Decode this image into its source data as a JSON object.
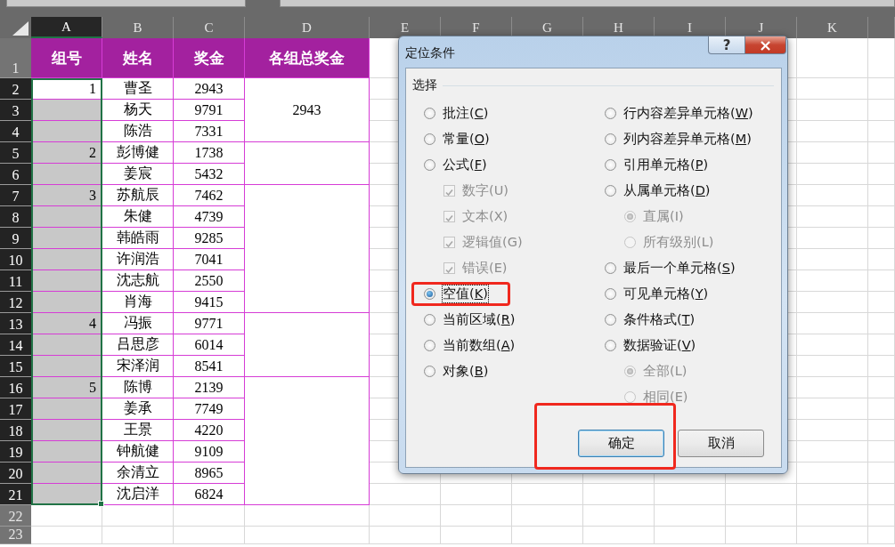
{
  "sheet": {
    "columns": [
      {
        "label": "A",
        "selected": true
      },
      {
        "label": "B",
        "selected": false
      },
      {
        "label": "C",
        "selected": false
      },
      {
        "label": "D",
        "selected": false
      },
      {
        "label": "E",
        "selected": false
      },
      {
        "label": "F",
        "selected": false
      },
      {
        "label": "G",
        "selected": false
      },
      {
        "label": "H",
        "selected": false
      },
      {
        "label": "I",
        "selected": false
      },
      {
        "label": "J",
        "selected": false
      },
      {
        "label": "K",
        "selected": false
      }
    ],
    "row_headers": [
      {
        "label": "1",
        "selected": false
      },
      {
        "label": "2",
        "selected": true
      },
      {
        "label": "3",
        "selected": true
      },
      {
        "label": "4",
        "selected": true
      },
      {
        "label": "5",
        "selected": true
      },
      {
        "label": "6",
        "selected": true
      },
      {
        "label": "7",
        "selected": true
      },
      {
        "label": "8",
        "selected": true
      },
      {
        "label": "9",
        "selected": true
      },
      {
        "label": "10",
        "selected": true
      },
      {
        "label": "11",
        "selected": true
      },
      {
        "label": "12",
        "selected": true
      },
      {
        "label": "13",
        "selected": true
      },
      {
        "label": "14",
        "selected": true
      },
      {
        "label": "15",
        "selected": true
      },
      {
        "label": "16",
        "selected": true
      },
      {
        "label": "17",
        "selected": true
      },
      {
        "label": "18",
        "selected": true
      },
      {
        "label": "19",
        "selected": true
      },
      {
        "label": "20",
        "selected": true
      },
      {
        "label": "21",
        "selected": true
      },
      {
        "label": "22",
        "selected": false
      },
      {
        "label": "23",
        "selected": false
      }
    ],
    "table": {
      "headers": [
        "组号",
        "姓名",
        "奖金",
        "各组总奖金"
      ],
      "groups": [
        {
          "number": "1",
          "total": "2943",
          "members": [
            {
              "name": "曹圣",
              "bonus": "2943",
              "selected": false
            },
            {
              "name": "杨天",
              "bonus": "9791",
              "selected": true
            },
            {
              "name": "陈浩",
              "bonus": "7331",
              "selected": true
            }
          ]
        },
        {
          "number": "2",
          "members": [
            {
              "name": "彭博健",
              "bonus": "1738",
              "selected": true
            },
            {
              "name": "姜宸",
              "bonus": "5432",
              "selected": true
            }
          ]
        },
        {
          "number": "3",
          "members": [
            {
              "name": "苏航辰",
              "bonus": "7462",
              "selected": true
            },
            {
              "name": "朱健",
              "bonus": "4739",
              "selected": true
            },
            {
              "name": "韩皓雨",
              "bonus": "9285",
              "selected": true
            },
            {
              "name": "许润浩",
              "bonus": "7041",
              "selected": true
            },
            {
              "name": "沈志航",
              "bonus": "2550",
              "selected": true
            },
            {
              "name": "肖海",
              "bonus": "9415",
              "selected": true
            }
          ]
        },
        {
          "number": "4",
          "members": [
            {
              "name": "冯振",
              "bonus": "9771",
              "selected": true
            },
            {
              "name": "吕思彦",
              "bonus": "6014",
              "selected": true
            },
            {
              "name": "宋泽润",
              "bonus": "8541",
              "selected": true
            }
          ]
        },
        {
          "number": "5",
          "members": [
            {
              "name": "陈博",
              "bonus": "2139",
              "selected": true
            },
            {
              "name": "姜承",
              "bonus": "7749",
              "selected": true
            },
            {
              "name": "王景",
              "bonus": "4220",
              "selected": true
            },
            {
              "name": "钟航健",
              "bonus": "9109",
              "selected": true
            },
            {
              "name": "余清立",
              "bonus": "8965",
              "selected": true
            },
            {
              "name": "沈启洋",
              "bonus": "6824",
              "selected": true
            }
          ]
        }
      ]
    }
  },
  "dialog": {
    "title": "定位条件",
    "help_button": "?",
    "close_button": "×",
    "group_label": "选择",
    "left_options": [
      {
        "kind": "radio",
        "label": "批注(C)",
        "selected": false,
        "disabled": false,
        "focused": false,
        "highlighted": false
      },
      {
        "kind": "radio",
        "label": "常量(O)",
        "selected": false,
        "disabled": false,
        "focused": false,
        "highlighted": false
      },
      {
        "kind": "radio",
        "label": "公式(F)",
        "selected": false,
        "disabled": false,
        "focused": false,
        "highlighted": false,
        "children": [
          {
            "kind": "checkbox",
            "label": "数字(U)",
            "checked": true,
            "disabled": true
          },
          {
            "kind": "checkbox",
            "label": "文本(X)",
            "checked": true,
            "disabled": true
          },
          {
            "kind": "checkbox",
            "label": "逻辑值(G)",
            "checked": true,
            "disabled": true
          },
          {
            "kind": "checkbox",
            "label": "错误(E)",
            "checked": true,
            "disabled": true
          }
        ]
      },
      {
        "kind": "radio",
        "label": "空值(K)",
        "selected": true,
        "disabled": false,
        "focused": true,
        "highlighted": true
      },
      {
        "kind": "radio",
        "label": "当前区域(R)",
        "selected": false,
        "disabled": false,
        "focused": false,
        "highlighted": false
      },
      {
        "kind": "radio",
        "label": "当前数组(A)",
        "selected": false,
        "disabled": false,
        "focused": false,
        "highlighted": false
      },
      {
        "kind": "radio",
        "label": "对象(B)",
        "selected": false,
        "disabled": false,
        "focused": false,
        "highlighted": false
      }
    ],
    "right_options": [
      {
        "kind": "radio",
        "label": "行内容差异单元格(W)",
        "selected": false,
        "disabled": false,
        "focused": false,
        "highlighted": false
      },
      {
        "kind": "radio",
        "label": "列内容差异单元格(M)",
        "selected": false,
        "disabled": false,
        "focused": false,
        "highlighted": false
      },
      {
        "kind": "radio",
        "label": "引用单元格(P)",
        "selected": false,
        "disabled": false,
        "focused": false,
        "highlighted": false
      },
      {
        "kind": "radio",
        "label": "从属单元格(D)",
        "selected": false,
        "disabled": false,
        "focused": false,
        "highlighted": false,
        "children": [
          {
            "kind": "radio",
            "label": "直属(I)",
            "selected": true,
            "disabled": true
          },
          {
            "kind": "radio",
            "label": "所有级别(L)",
            "selected": false,
            "disabled": true
          }
        ]
      },
      {
        "kind": "radio",
        "label": "最后一个单元格(S)",
        "selected": false,
        "disabled": false,
        "focused": false,
        "highlighted": false
      },
      {
        "kind": "radio",
        "label": "可见单元格(Y)",
        "selected": false,
        "disabled": false,
        "focused": false,
        "highlighted": false
      },
      {
        "kind": "radio",
        "label": "条件格式(T)",
        "selected": false,
        "disabled": false,
        "focused": false,
        "highlighted": false
      },
      {
        "kind": "radio",
        "label": "数据验证(V)",
        "selected": false,
        "disabled": false,
        "focused": false,
        "highlighted": false,
        "children": [
          {
            "kind": "radio",
            "label": "全部(L)",
            "selected": true,
            "disabled": true
          },
          {
            "kind": "radio",
            "label": "相同(E)",
            "selected": false,
            "disabled": true
          }
        ]
      }
    ],
    "buttons": [
      {
        "label": "确定",
        "default": true,
        "highlighted": true
      },
      {
        "label": "取消",
        "default": false
      }
    ]
  }
}
